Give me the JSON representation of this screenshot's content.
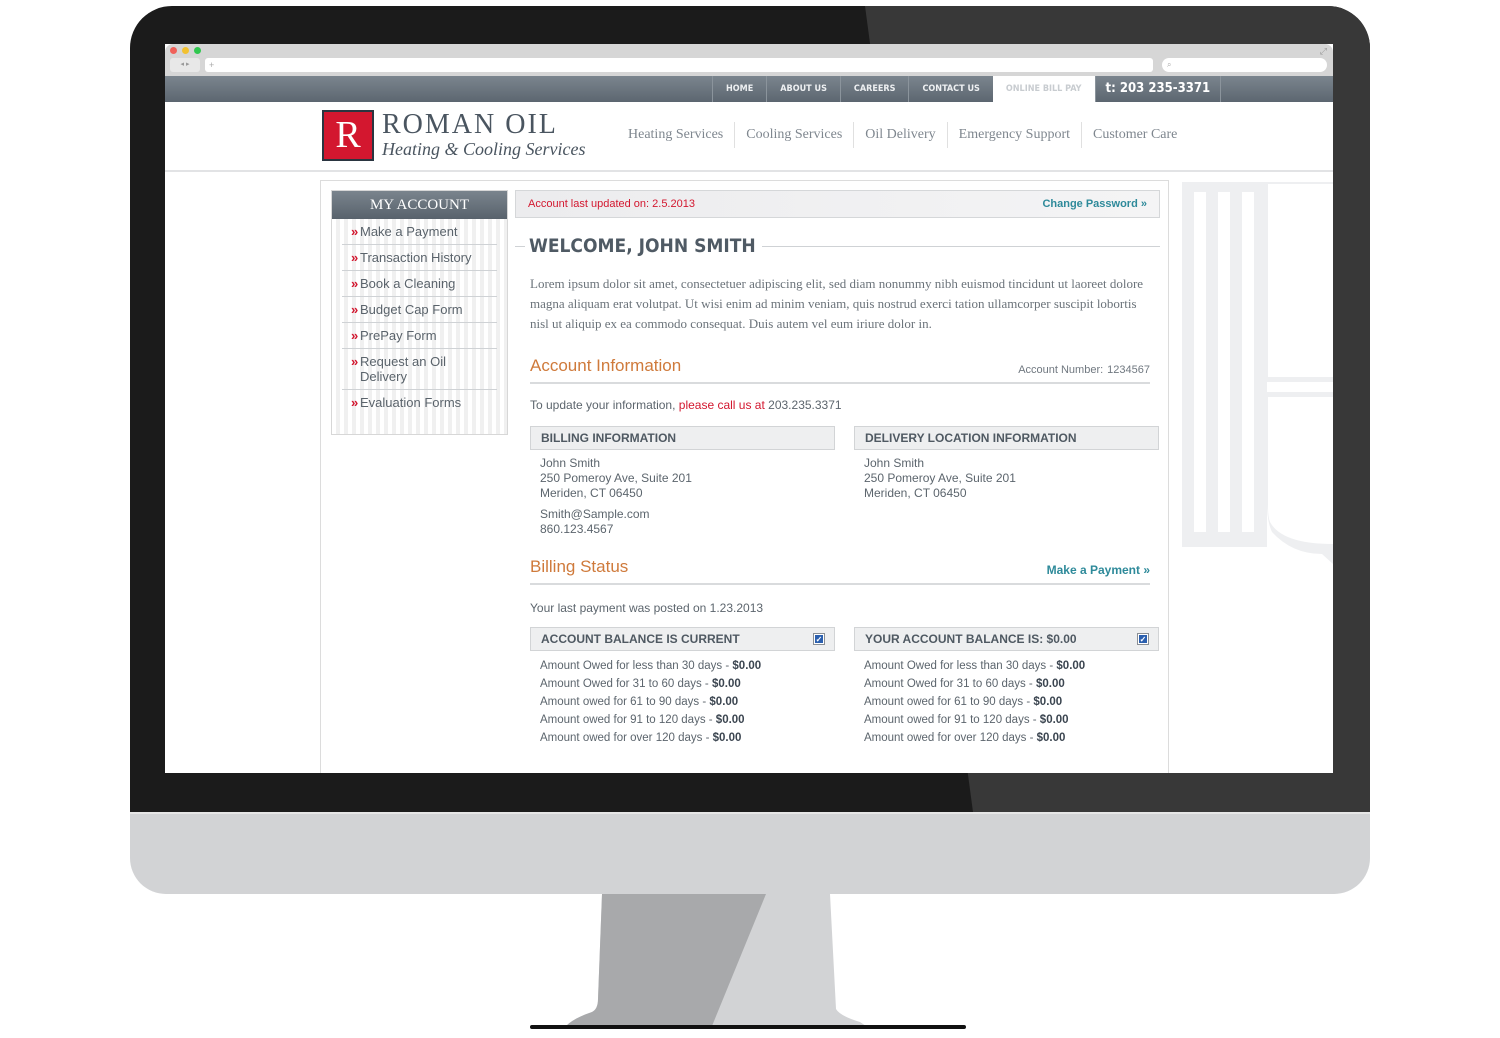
{
  "browser": {
    "url": "+",
    "search_placeholder": "",
    "back_label": "◂",
    "forward_label": "▸"
  },
  "topnav": {
    "items": [
      {
        "label": "HOME"
      },
      {
        "label": "ABOUT US"
      },
      {
        "label": "CAREERS"
      },
      {
        "label": "CONTACT US"
      },
      {
        "label": "ONLINE BILL PAY",
        "active": true
      }
    ],
    "phone": "t: 203 235-3371"
  },
  "brand": {
    "letter": "R",
    "name": "ROMAN OIL",
    "tagline": "Heating & Cooling Services",
    "color": "#d3172f"
  },
  "mainnav": {
    "items": [
      {
        "label": "Heating Services"
      },
      {
        "label": "Cooling Services"
      },
      {
        "label": "Oil Delivery"
      },
      {
        "label": "Emergency Support"
      },
      {
        "label": "Customer Care"
      }
    ]
  },
  "sidebar": {
    "title": "MY ACCOUNT",
    "bullet": "»",
    "items": [
      {
        "label": "Make a Payment"
      },
      {
        "label": "Transaction History"
      },
      {
        "label": "Book a Cleaning"
      },
      {
        "label": "Budget Cap Form"
      },
      {
        "label": "PrePay Form"
      },
      {
        "label": "Request an Oil Delivery"
      },
      {
        "label": "Evaluation Forms"
      }
    ]
  },
  "status": {
    "updated": "Account last updated on: 2.5.2013",
    "change_password": "Change Password »"
  },
  "welcome": {
    "title": "WELCOME, JOHN SMITH",
    "body": "Lorem ipsum dolor sit amet, consectetuer adipiscing elit, sed diam nonummy nibh euismod tincidunt ut laoreet dolore magna aliquam erat volutpat. Ut wisi enim ad minim veniam, quis nostrud exerci tation ullamcorper suscipit lobortis nisl ut aliquip ex ea commodo consequat. Duis autem vel eum iriure dolor in."
  },
  "account_info": {
    "title": "Account Information",
    "account_number_label": "Account Number:",
    "account_number": "1234567",
    "update_prefix": "To update your information, ",
    "update_call": "please call us at",
    "update_phone": " 203.235.3371",
    "billing": {
      "heading": "BILLING INFORMATION",
      "name": "John Smith",
      "street": "250 Pomeroy Ave, Suite 201",
      "city": "Meriden, CT 06450",
      "email": "Smith@Sample.com",
      "phone": "860.123.4567"
    },
    "delivery": {
      "heading": "DELIVERY LOCATION INFORMATION",
      "name": "John Smith",
      "street": "250 Pomeroy Ave, Suite 201",
      "city": "Meriden, CT 06450"
    }
  },
  "billing_status": {
    "title": "Billing Status",
    "make_payment": "Make a Payment »",
    "last_payment": "Your last payment was posted on 1.23.2013",
    "left": {
      "heading": "ACCOUNT BALANCE IS CURRENT",
      "checked": true,
      "rows": [
        {
          "label": "Amount Owed for less than 30 days - ",
          "amount": "$0.00"
        },
        {
          "label": "Amount Owed for 31 to 60 days - ",
          "amount": "$0.00"
        },
        {
          "label": "Amount owed for 61 to 90 days - ",
          "amount": "$0.00"
        },
        {
          "label": "Amount owed for 91 to 120 days - ",
          "amount": "$0.00"
        },
        {
          "label": "Amount owed for over 120 days - ",
          "amount": "$0.00"
        }
      ]
    },
    "right": {
      "heading": "YOUR ACCOUNT BALANCE IS: $0.00",
      "checked": true,
      "rows": [
        {
          "label": "Amount Owed for less than 30 days - ",
          "amount": "$0.00"
        },
        {
          "label": "Amount Owed for 31 to 60 days - ",
          "amount": "$0.00"
        },
        {
          "label": "Amount owed for 61 to 90 days - ",
          "amount": "$0.00"
        },
        {
          "label": "Amount owed for 91 to 120 days - ",
          "amount": "$0.00"
        },
        {
          "label": "Amount owed for over 120 days - ",
          "amount": "$0.00"
        }
      ]
    }
  },
  "colors": {
    "accent_red": "#d3172f",
    "accent_orange": "#cf7a3b",
    "link_teal": "#2e8a9a",
    "nav_slate": "#5c6670"
  }
}
